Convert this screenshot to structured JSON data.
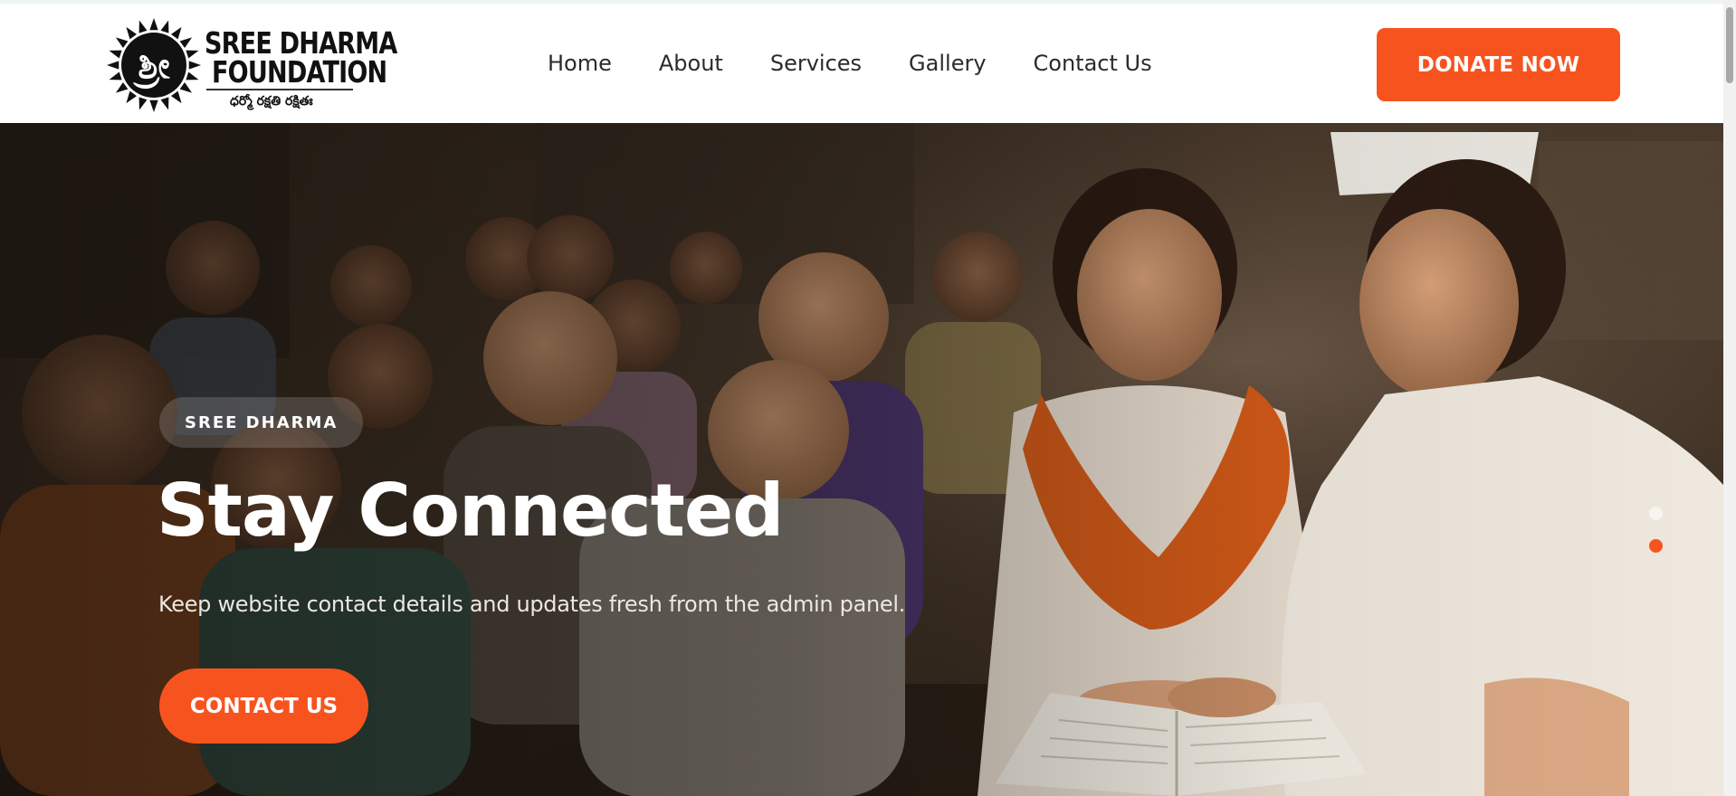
{
  "brand": {
    "name_line1": "SREE DHARMA",
    "name_line2": "FOUNDATION",
    "tagline": "ధర్మో రక్షతి రక్షితః",
    "emblem_glyph": "శ్రీ",
    "emblem_icon": "sun-emblem-icon"
  },
  "nav": {
    "items": [
      {
        "label": "Home"
      },
      {
        "label": "About"
      },
      {
        "label": "Services"
      },
      {
        "label": "Gallery"
      },
      {
        "label": "Contact Us"
      }
    ]
  },
  "header": {
    "donate_label": "DONATE NOW"
  },
  "hero": {
    "badge": "SREE DHARMA",
    "title": "Stay Connected",
    "subtitle": "Keep website contact details and updates fresh from the admin panel.",
    "cta_label": "CONTACT US",
    "slides_total": 2,
    "active_slide": 2,
    "image_description_icon": "classroom-photo"
  },
  "colors": {
    "accent": "#f7531f",
    "nav_text": "#2b2b2b",
    "header_bg": "#ffffff",
    "hero_text": "#ffffff"
  }
}
